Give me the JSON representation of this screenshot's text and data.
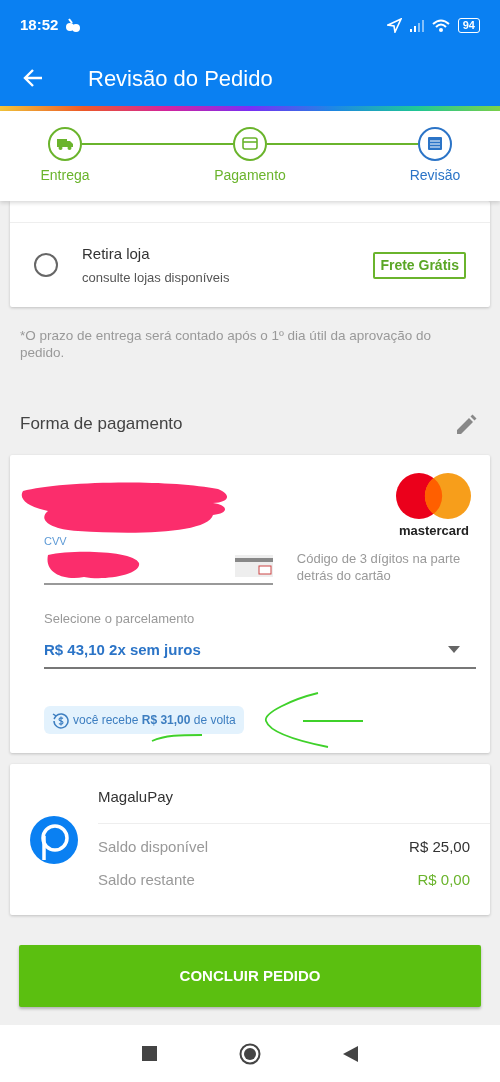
{
  "status_bar": {
    "time": "18:52",
    "battery": "94"
  },
  "app_bar": {
    "title": "Revisão do Pedido"
  },
  "steps": [
    {
      "label": "Entrega",
      "kind": "truck",
      "selected": false
    },
    {
      "label": "Pagamento",
      "kind": "card",
      "selected": false
    },
    {
      "label": "Revisão",
      "kind": "list",
      "selected": true
    }
  ],
  "shipping_options": [
    {
      "title": "Retira loja",
      "subtitle": "consulte lojas disponíveis",
      "tag": "Frete Grátis",
      "selected": false
    }
  ],
  "note": "*O prazo de entrega será contado após o 1º dia útil da aprovação do pedido.",
  "payment": {
    "header": "Forma de pagamento",
    "brand": "mastercard",
    "cvv_label": "CVV",
    "cvv_hint": "Código de 3 dígitos na parte detrás do cartão",
    "installments_label": "Selecione o parcelamento",
    "installments_value": "R$ 43,10 2x sem juros",
    "cashback": "você recebe **R$ 31,00** de volta"
  },
  "wallet": {
    "name": "MagaluPay",
    "rows": [
      {
        "label": "Saldo disponível",
        "value": "R$ 25,00",
        "kind": "available"
      },
      {
        "label": "Saldo restante",
        "value": "R$ 0,00",
        "kind": "remaining"
      }
    ]
  },
  "submit": "CONCLUIR PEDIDO"
}
